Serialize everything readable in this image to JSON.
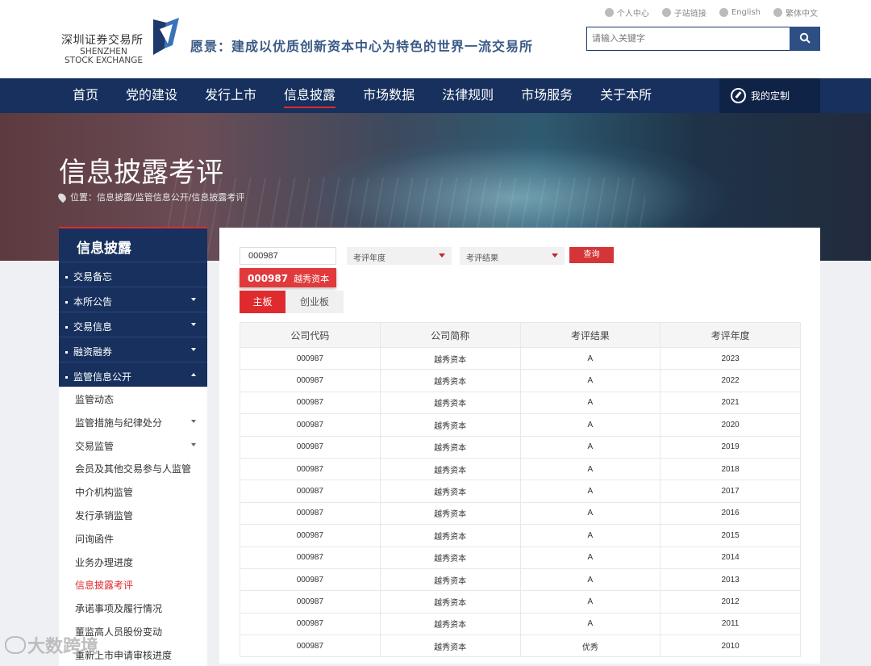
{
  "header": {
    "logo_cn": "深圳证券交易所",
    "logo_en_1": "SHENZHEN",
    "logo_en_2": "STOCK EXCHANGE",
    "slogan": "愿景：建成以优质创新资本中心为特色的世界一流交易所",
    "links": [
      "个人中心",
      "子站链接",
      "English",
      "繁体中文"
    ],
    "search_placeholder": "请输入关键字"
  },
  "nav": {
    "items": [
      "首页",
      "党的建设",
      "发行上市",
      "信息披露",
      "市场数据",
      "法律规则",
      "市场服务",
      "关于本所"
    ],
    "active": "信息披露",
    "custom": "我的定制"
  },
  "banner": {
    "title": "信息披露考评",
    "breadcrumb": "位置：信息披露/监管信息公开/信息披露考评"
  },
  "sidebar": {
    "title": "信息披露",
    "items": [
      {
        "label": "交易备忘",
        "caret": ""
      },
      {
        "label": "本所公告",
        "caret": "down"
      },
      {
        "label": "交易信息",
        "caret": "down"
      },
      {
        "label": "融资融券",
        "caret": "down"
      },
      {
        "label": "监管信息公开",
        "caret": "up"
      }
    ],
    "subitems": [
      {
        "label": "监管动态",
        "caret": false
      },
      {
        "label": "监管措施与纪律处分",
        "caret": true
      },
      {
        "label": "交易监管",
        "caret": true
      },
      {
        "label": "会员及其他交易参与人监管",
        "caret": false
      },
      {
        "label": "中介机构监管",
        "caret": false
      },
      {
        "label": "发行承销监管",
        "caret": false
      },
      {
        "label": "问询函件",
        "caret": false
      },
      {
        "label": "业务办理进度",
        "caret": false
      },
      {
        "label": "信息披露考评",
        "caret": false,
        "active": true
      },
      {
        "label": "承诺事项及履行情况",
        "caret": false
      },
      {
        "label": "董监高人员股份变动",
        "caret": false
      },
      {
        "label": "重新上市申请审核进度",
        "caret": false
      }
    ]
  },
  "filters": {
    "code_value": "000987",
    "year_placeholder": "考评年度",
    "result_placeholder": "考评结果",
    "query_label": "查询",
    "suggest_code": "000987",
    "suggest_name": "越秀资本"
  },
  "tabs": [
    "主板",
    "创业板"
  ],
  "table": {
    "headers": [
      "公司代码",
      "公司简称",
      "考评结果",
      "考评年度"
    ],
    "rows": [
      [
        "000987",
        "越秀资本",
        "A",
        "2023"
      ],
      [
        "000987",
        "越秀资本",
        "A",
        "2022"
      ],
      [
        "000987",
        "越秀资本",
        "A",
        "2021"
      ],
      [
        "000987",
        "越秀资本",
        "A",
        "2020"
      ],
      [
        "000987",
        "越秀资本",
        "A",
        "2019"
      ],
      [
        "000987",
        "越秀资本",
        "A",
        "2018"
      ],
      [
        "000987",
        "越秀资本",
        "A",
        "2017"
      ],
      [
        "000987",
        "越秀资本",
        "A",
        "2016"
      ],
      [
        "000987",
        "越秀资本",
        "A",
        "2015"
      ],
      [
        "000987",
        "越秀资本",
        "A",
        "2014"
      ],
      [
        "000987",
        "越秀资本",
        "A",
        "2013"
      ],
      [
        "000987",
        "越秀资本",
        "A",
        "2012"
      ],
      [
        "000987",
        "越秀资本",
        "A",
        "2011"
      ],
      [
        "000987",
        "越秀资本",
        "优秀",
        "2010"
      ]
    ]
  },
  "watermark": "大数跨境"
}
